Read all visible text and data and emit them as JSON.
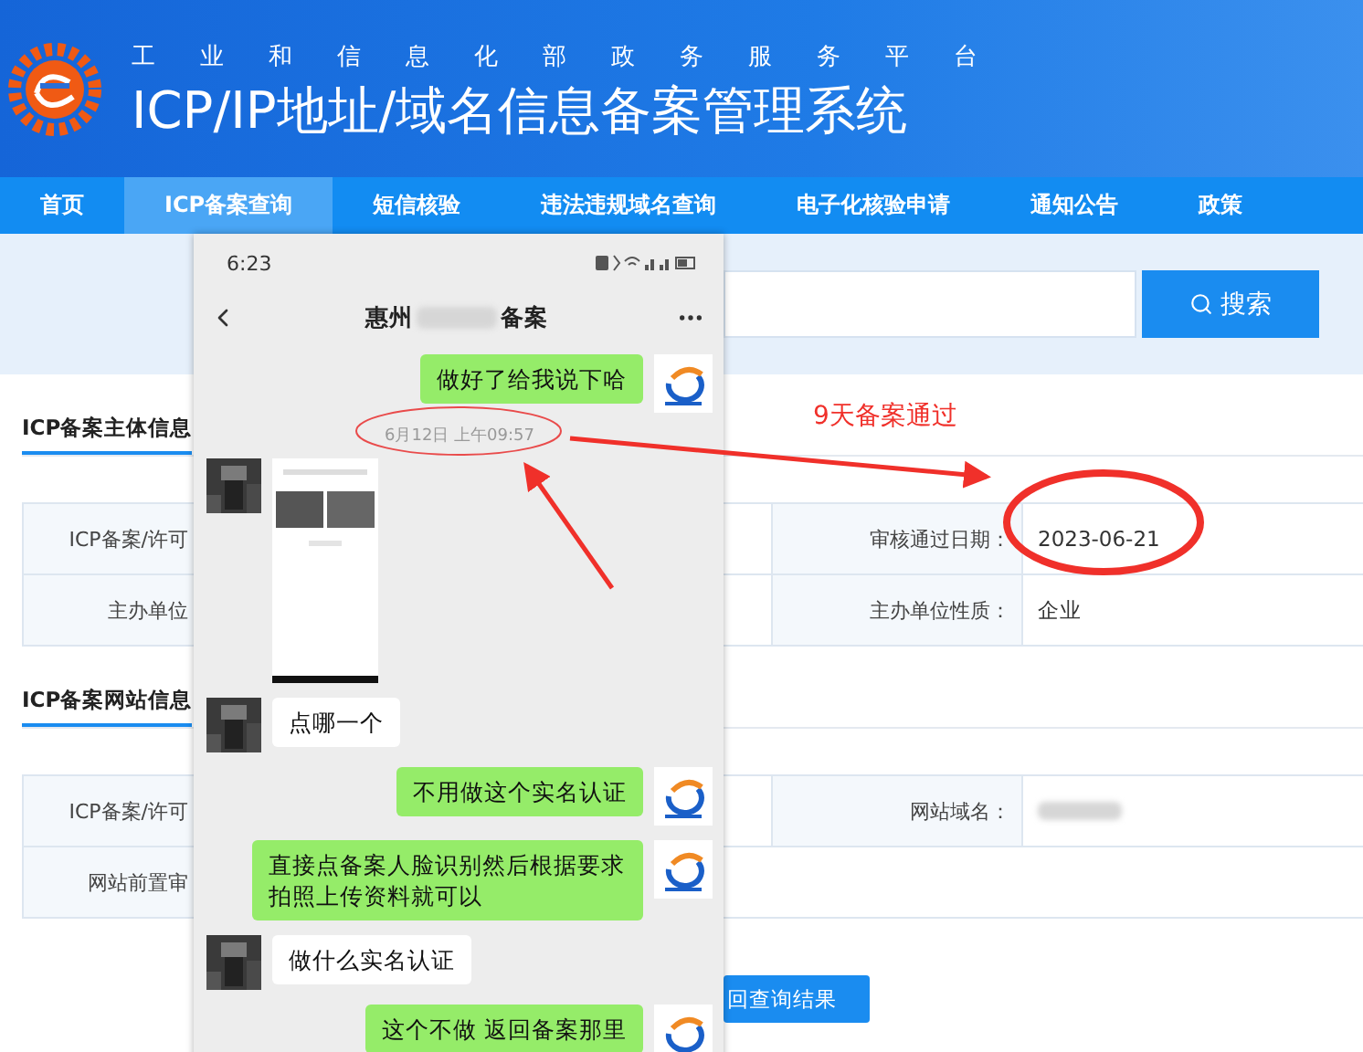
{
  "header": {
    "subtitle": "工业和信息化部政务服务平台",
    "title": "ICP/IP地址/域名信息备案管理系统"
  },
  "nav": [
    {
      "label": "首页",
      "selected": false
    },
    {
      "label": "ICP备案查询",
      "selected": true
    },
    {
      "label": "短信核验",
      "selected": false
    },
    {
      "label": "违法违规域名查询",
      "selected": false
    },
    {
      "label": "电子化核验申请",
      "selected": false
    },
    {
      "label": "通知公告",
      "selected": false
    },
    {
      "label": "政策",
      "selected": false
    }
  ],
  "search": {
    "button": "搜索"
  },
  "sections": [
    {
      "title": "ICP备案主体信息",
      "rows": [
        {
          "label_1": "ICP备案/许可",
          "label_2": "审核通过日期：",
          "value_2": "2023-06-21"
        },
        {
          "label_1": "主办单位",
          "label_2": "主办单位性质：",
          "value_2": "企业"
        }
      ]
    },
    {
      "title": "ICP备案网站信息",
      "rows": [
        {
          "label_1": "ICP备案/许可",
          "label_2": "网站域名：",
          "redacted": true
        },
        {
          "label_1": "网站前置审"
        }
      ]
    }
  ],
  "return_button": "回查询结果",
  "phone": {
    "time": "6:23",
    "title_start": "惠州",
    "title_end": "备案",
    "messages": [
      {
        "kind": "sent",
        "text": "做好了给我说下哈"
      },
      {
        "kind": "timestamp",
        "text": "6月12日 上午09:57"
      },
      {
        "kind": "received_image"
      },
      {
        "kind": "received",
        "text": "点哪一个"
      },
      {
        "kind": "sent",
        "text": "不用做这个实名认证"
      },
      {
        "kind": "sent",
        "text": "直接点备案人脸识别然后根据要求拍照上传资料就可以"
      },
      {
        "kind": "received",
        "text": "做什么实名认证"
      },
      {
        "kind": "sent",
        "text": "这个不做 返回备案那里"
      }
    ]
  },
  "annotation": {
    "text": "9天备案通过"
  }
}
